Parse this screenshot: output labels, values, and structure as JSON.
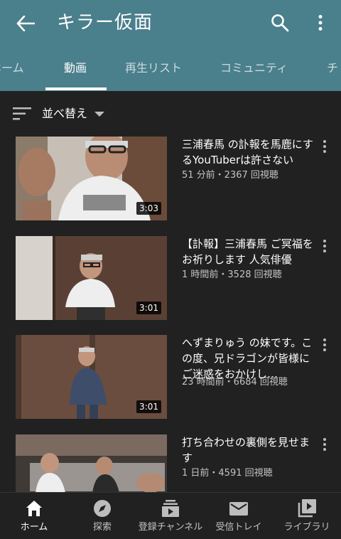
{
  "header": {
    "title": "キラー仮面",
    "back_icon": "arrow-left-icon",
    "search_icon": "search-icon",
    "more_icon": "more-vert-icon",
    "color": "#4a7f8c"
  },
  "tabs": [
    {
      "label": "ホーム"
    },
    {
      "label": "動画"
    },
    {
      "label": "再生リスト"
    },
    {
      "label": "コミュニティ"
    },
    {
      "label": "チ"
    }
  ],
  "sort": {
    "label": "並べ替え"
  },
  "videos": [
    {
      "title": "三浦春馬 の訃報を馬鹿にするYouTuberは許さない",
      "meta": "51 分前・2367 回視聴",
      "duration": "3:03"
    },
    {
      "title": "【訃報】三浦春馬 ご冥福をお祈りします 人気俳優",
      "meta": "1 時間前・3528 回視聴",
      "duration": "3:01"
    },
    {
      "title": "へずまりゅう の妹です。この度、兄ドラゴンが皆様にご迷惑をおかけし…",
      "meta": "23 時間前・6684 回視聴",
      "duration": "3:01"
    },
    {
      "title": "打ち合わせの裏側を見せます",
      "meta": "1 日前・4591 回視聴",
      "duration": ""
    }
  ],
  "nav": [
    {
      "label": "ホーム",
      "icon": "home-icon"
    },
    {
      "label": "探索",
      "icon": "explore-icon"
    },
    {
      "label": "登録チャンネル",
      "icon": "subscriptions-icon"
    },
    {
      "label": "受信トレイ",
      "icon": "inbox-icon"
    },
    {
      "label": "ライブラリ",
      "icon": "library-icon"
    }
  ]
}
